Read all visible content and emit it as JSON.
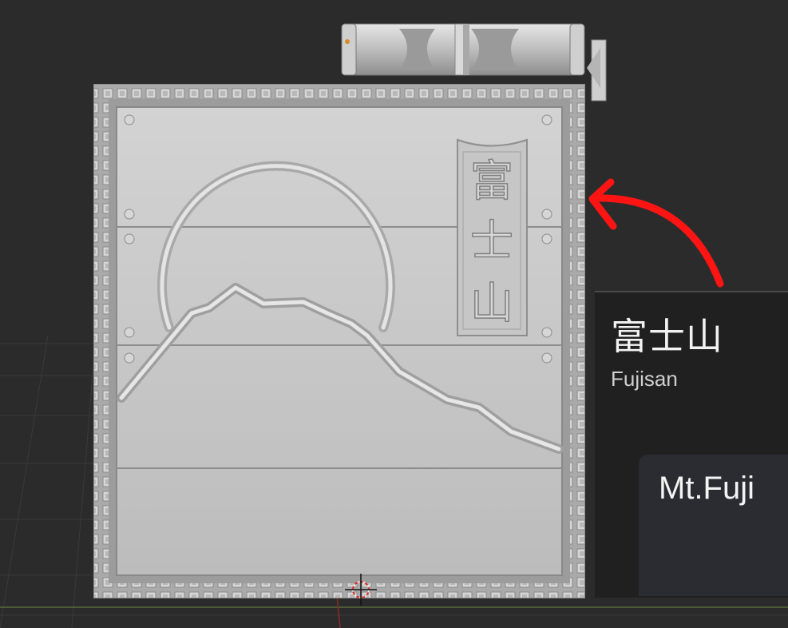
{
  "panel": {
    "kanji": "富士山",
    "romaji": "Fujisan",
    "english": "Mt.Fuji"
  },
  "plaque": {
    "banner_chars": [
      "富",
      "士",
      "山"
    ]
  },
  "colors": {
    "background": "#2b2b2b",
    "panel": "#202020",
    "name_box": "#2a2c31",
    "arrow": "#ff1414",
    "model_gray": "#c4c4c4"
  }
}
